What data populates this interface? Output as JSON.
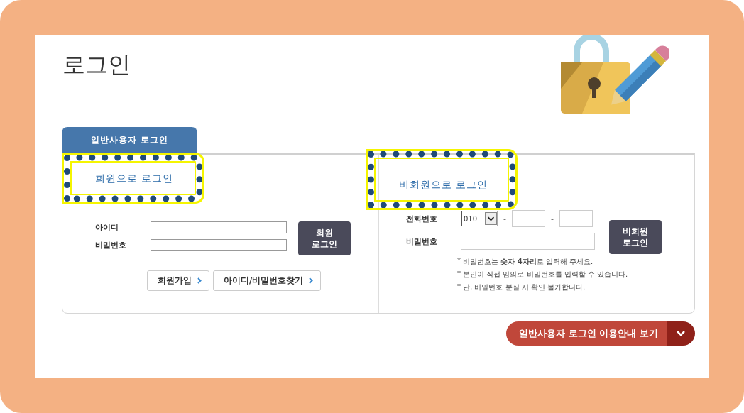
{
  "title": "로그인",
  "tabs": [
    {
      "label": "일반사용자 로그인",
      "selected": true
    }
  ],
  "member_login": {
    "heading": "회원으로 로그인",
    "highlighted": true,
    "fields": [
      {
        "label": "아이디"
      },
      {
        "label": "비밀번호"
      }
    ],
    "button": "회원\n로그인",
    "links": [
      "회원가입",
      "아이디/비밀번호찾기"
    ]
  },
  "guest_login": {
    "heading": "비회원으로 로그인",
    "highlighted": true,
    "phone": {
      "label": "전화번호",
      "prefix": "010",
      "separators": [
        "-",
        "-"
      ]
    },
    "password": {
      "label": "비밀번호"
    },
    "button": "비회원\n로그인",
    "notes": [
      {
        "bullet": "*",
        "text": "비밀번호는 **숫자 4자리**로 입력해 주세요."
      },
      {
        "bullet": "*",
        "text": "본인이 직접 임의로 비밀번호를 입력할 수 있습니다."
      },
      {
        "bullet": "*",
        "text": "단, 비밀번호 분실 시 확인 불가합니다."
      }
    ]
  },
  "guide_button": {
    "label": "일반사용자 로그인 이용안내 보기",
    "expanded": false
  }
}
